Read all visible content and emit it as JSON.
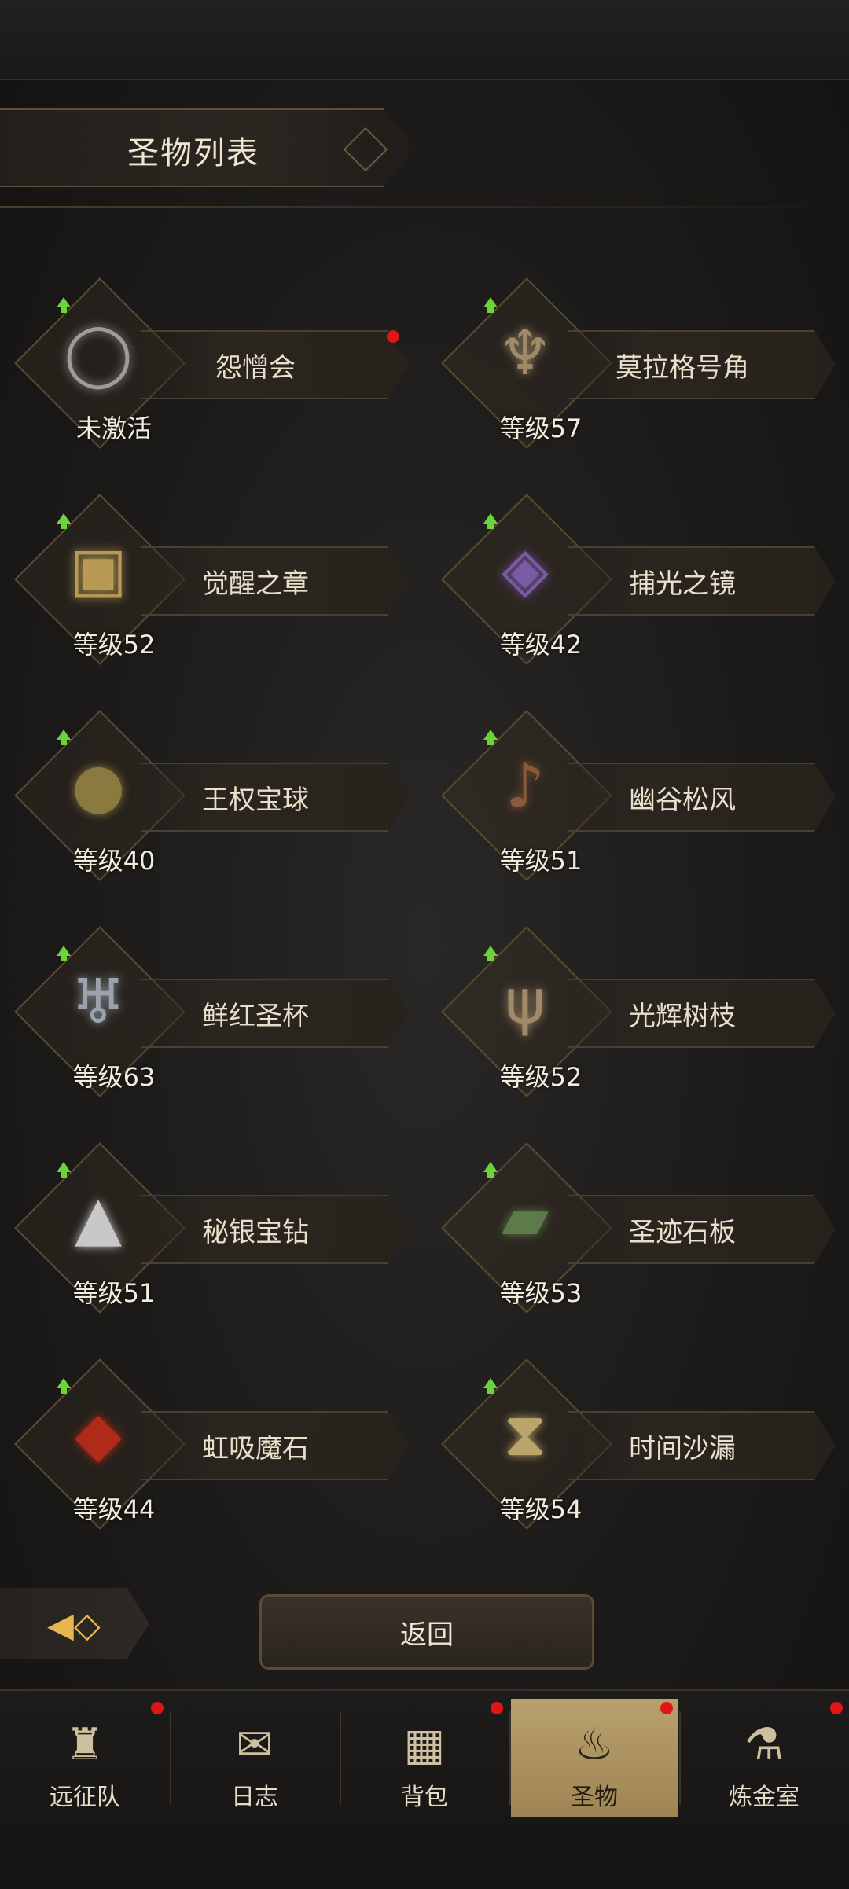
{
  "header": {
    "title": "圣物列表"
  },
  "relics": [
    {
      "name": "怨憎会",
      "level": "未激活",
      "icon": "bracelet-icon",
      "glyph": "◯",
      "color": "#9c9c9c",
      "dot": true
    },
    {
      "name": "莫拉格号角",
      "level": "等级57",
      "icon": "horn-icon",
      "glyph": "♆",
      "color": "#a08a6a",
      "dot": false
    },
    {
      "name": "觉醒之章",
      "level": "等级52",
      "icon": "book-icon",
      "glyph": "▣",
      "color": "#b89a55",
      "dot": false
    },
    {
      "name": "捕光之镜",
      "level": "等级42",
      "icon": "mirror-icon",
      "glyph": "◈",
      "color": "#7a5aa6",
      "dot": false
    },
    {
      "name": "王权宝球",
      "level": "等级40",
      "icon": "orb-icon",
      "glyph": "●",
      "color": "#8a7a40",
      "dot": false
    },
    {
      "name": "幽谷松风",
      "level": "等级51",
      "icon": "lute-icon",
      "glyph": "♪",
      "color": "#8a5a3a",
      "dot": false
    },
    {
      "name": "鲜红圣杯",
      "level": "等级63",
      "icon": "chalice-icon",
      "glyph": "♅",
      "color": "#9aa3ad",
      "dot": false
    },
    {
      "name": "光辉树枝",
      "level": "等级52",
      "icon": "branch-icon",
      "glyph": "ψ",
      "color": "#a08a6a",
      "dot": false
    },
    {
      "name": "秘银宝钻",
      "level": "等级51",
      "icon": "pyramid-icon",
      "glyph": "▲",
      "color": "#c8c8c8",
      "dot": false
    },
    {
      "name": "圣迹石板",
      "level": "等级53",
      "icon": "tablet-icon",
      "glyph": "▰",
      "color": "#5c7a4a",
      "dot": false
    },
    {
      "name": "虹吸魔石",
      "level": "等级44",
      "icon": "stone-icon",
      "glyph": "◆",
      "color": "#b02a1a",
      "dot": false
    },
    {
      "name": "时间沙漏",
      "level": "等级54",
      "icon": "hourglass-icon",
      "glyph": "⧗",
      "color": "#b9a56a",
      "dot": false
    }
  ],
  "buttons": {
    "back": "返回"
  },
  "nav": [
    {
      "label": "远征队",
      "icon": "helmet-icon",
      "glyph": "♜",
      "dot": true,
      "active": false
    },
    {
      "label": "日志",
      "icon": "scroll-icon",
      "glyph": "✉",
      "dot": false,
      "active": false
    },
    {
      "label": "背包",
      "icon": "backpack-icon",
      "glyph": "▦",
      "dot": true,
      "active": false
    },
    {
      "label": "圣物",
      "icon": "brazier-icon",
      "glyph": "♨",
      "dot": true,
      "active": true
    },
    {
      "label": "炼金室",
      "icon": "alchemy-icon",
      "glyph": "⚗",
      "dot": true,
      "active": false
    }
  ]
}
